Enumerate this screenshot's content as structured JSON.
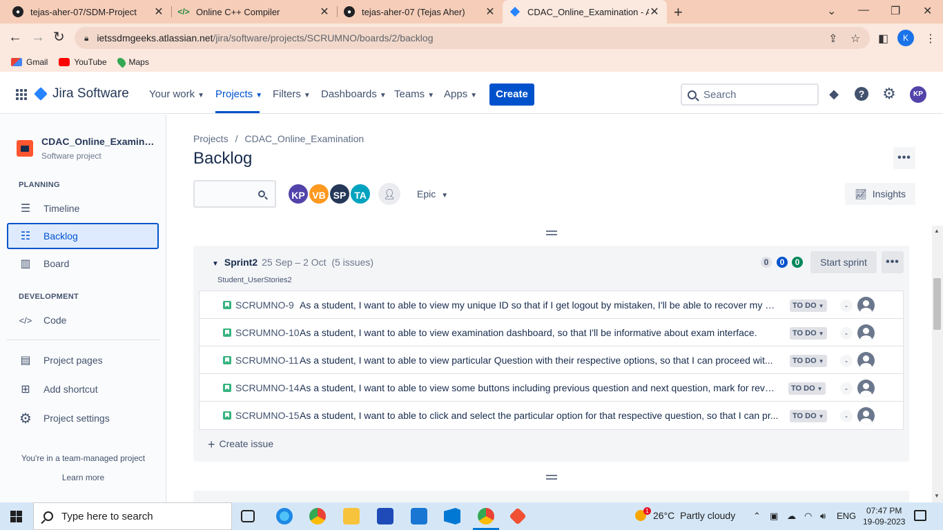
{
  "browser": {
    "tabs": [
      {
        "title": "tejas-aher-07/SDM-Project",
        "icon": "github-icon"
      },
      {
        "title": "Online C++ Compiler",
        "icon": "code-icon"
      },
      {
        "title": "tejas-aher-07 (Tejas Aher)",
        "icon": "github-icon"
      },
      {
        "title": "CDAC_Online_Examination - Agile",
        "icon": "jira-icon"
      }
    ],
    "url_host": "ietssdmgeeks.atlassian.net",
    "url_path": "/jira/software/projects/SCRUMNO/boards/2/backlog",
    "profile_initial": "K",
    "bookmarks": [
      "Gmail",
      "YouTube",
      "Maps"
    ]
  },
  "jira_nav": {
    "product": "Jira Software",
    "items": [
      {
        "label": "Your work"
      },
      {
        "label": "Projects"
      },
      {
        "label": "Filters"
      },
      {
        "label": "Dashboards"
      },
      {
        "label": "Teams"
      },
      {
        "label": "Apps"
      }
    ],
    "create_label": "Create",
    "search_placeholder": "Search",
    "user_initials": "KP"
  },
  "sidebar": {
    "project_name": "CDAC_Online_Examination",
    "project_type": "Software project",
    "planning_heading": "PLANNING",
    "development_heading": "DEVELOPMENT",
    "items": {
      "timeline": "Timeline",
      "backlog": "Backlog",
      "board": "Board",
      "code": "Code",
      "project_pages": "Project pages",
      "add_shortcut": "Add shortcut",
      "project_settings": "Project settings"
    },
    "team_note": "You're in a team-managed project",
    "learn_more": "Learn more"
  },
  "main": {
    "breadcrumb": [
      "Projects",
      "/",
      "CDAC_Online_Examination"
    ],
    "title": "Backlog",
    "avatars": [
      {
        "initials": "KP",
        "color": "#5243aa"
      },
      {
        "initials": "VB",
        "color": "#ff991f"
      },
      {
        "initials": "SP",
        "color": "#253858"
      },
      {
        "initials": "TA",
        "color": "#00a3bf"
      }
    ],
    "epic_label": "Epic",
    "insights_label": "Insights"
  },
  "sprint": {
    "name": "Sprint2",
    "dates": "25 Sep – 2 Oct",
    "issue_count": "(5 issues)",
    "goal": "Student_UserStories2",
    "counts": {
      "todo": "0",
      "in_progress": "0",
      "done": "0"
    },
    "start_label": "Start sprint",
    "issues": [
      {
        "key": "SCRUMNO-9",
        "summary": "As a student, I want to able to view my unique ID so that if I get logout by mistaken, I'll be able to recover my d...",
        "status": "TO DO",
        "points": "-"
      },
      {
        "key": "SCRUMNO-10",
        "summary": "As a student, I want to able to view examination dashboard, so that I'll be informative about exam interface.",
        "status": "TO DO",
        "points": "-"
      },
      {
        "key": "SCRUMNO-11",
        "summary": "As a student, I want to able to view particular Question with their respective options, so that I can proceed wit...",
        "status": "TO DO",
        "points": "-"
      },
      {
        "key": "SCRUMNO-14",
        "summary": "As a student, I want to able to view some buttons including previous question and next question, mark for revi...",
        "status": "TO DO",
        "points": "-"
      },
      {
        "key": "SCRUMNO-15",
        "summary": "As a student, I want to able to click and select the particular option for that respective question, so that I can pr...",
        "status": "TO DO",
        "points": "-"
      }
    ],
    "create_issue": "Create issue"
  },
  "taskbar": {
    "search_placeholder": "Type here to search",
    "weather_temp": "26°C",
    "weather_desc": "Partly cloudy",
    "weather_badge": "1",
    "language": "ENG",
    "time": "07:47 PM",
    "date": "19-09-2023"
  }
}
